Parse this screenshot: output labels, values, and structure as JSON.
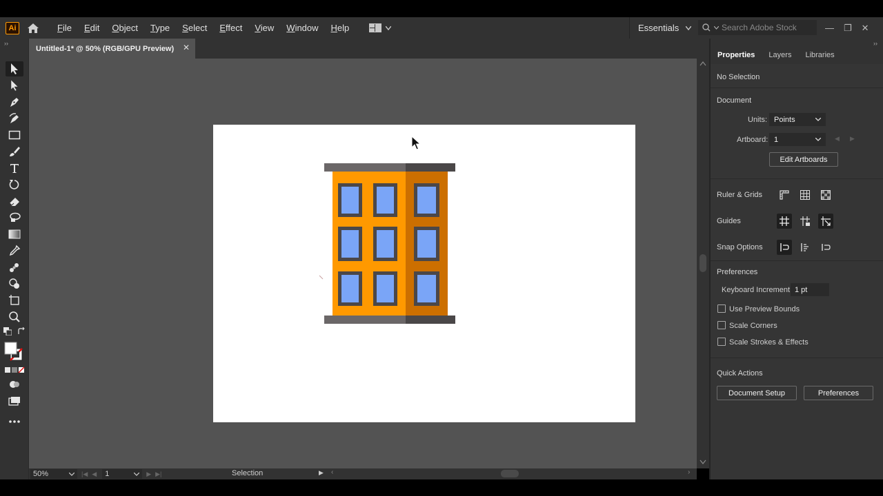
{
  "app": {
    "logo_text": "Ai"
  },
  "menu": {
    "items": [
      "File",
      "Edit",
      "Object",
      "Type",
      "Select",
      "Effect",
      "View",
      "Window",
      "Help"
    ]
  },
  "workspace": {
    "label": "Essentials"
  },
  "search": {
    "placeholder": "Search Adobe Stock"
  },
  "document": {
    "tab_title": "Untitled-1* @ 50% (RGB/GPU Preview)",
    "close_glyph": "✕"
  },
  "status": {
    "zoom": "50%",
    "page": "1",
    "tool_label": "Selection"
  },
  "panel": {
    "tabs": [
      "Properties",
      "Layers",
      "Libraries"
    ],
    "no_selection": "No Selection",
    "document_heading": "Document",
    "units_label": "Units:",
    "units_value": "Points",
    "artboard_label": "Artboard:",
    "artboard_value": "1",
    "edit_artboards": "Edit Artboards",
    "ruler_grids": "Ruler & Grids",
    "guides": "Guides",
    "snap_options": "Snap Options",
    "preferences_heading": "Preferences",
    "keyboard_increment_label": "Keyboard Increment:",
    "keyboard_increment_value": "1 pt",
    "use_preview_bounds": "Use Preview Bounds",
    "scale_corners": "Scale Corners",
    "scale_strokes": "Scale Strokes & Effects",
    "quick_actions": "Quick Actions",
    "document_setup": "Document Setup",
    "preferences_button": "Preferences"
  },
  "colors": {
    "building_orange": "#ff9900",
    "building_shade": "#cc6f00",
    "roof": "#6b6768",
    "roof_shade": "#4a4748",
    "window_frame": "#4b4748",
    "window_glass": "#7aa5f7"
  }
}
